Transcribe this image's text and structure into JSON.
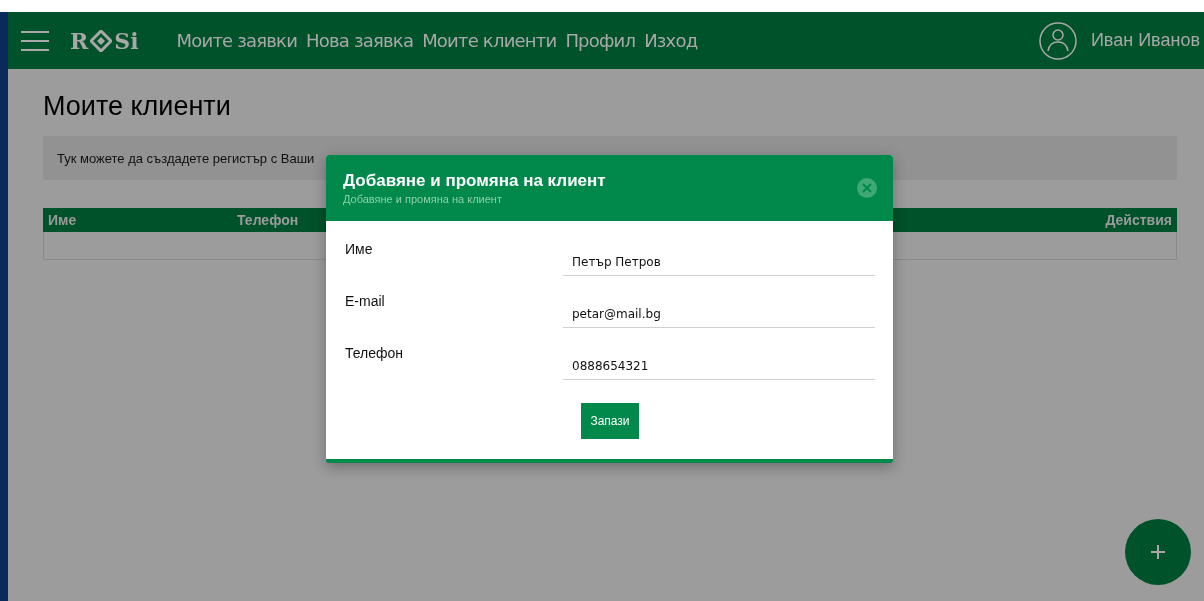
{
  "header": {
    "logo": {
      "left": "R",
      "right": "Si"
    },
    "nav": [
      {
        "label": "Моите заявки",
        "selected": false
      },
      {
        "label": "Нова заявка",
        "selected": false
      },
      {
        "label": "Моите клиенти",
        "selected": false
      },
      {
        "label": "Профил",
        "selected": false
      },
      {
        "label": "Изход",
        "selected": false
      }
    ],
    "user": "Иван Иванов"
  },
  "page": {
    "title": "Моите клиенти",
    "info": "Тук можете да създадете регистър с Ваши",
    "table": {
      "columns": [
        "Име",
        "Телефон",
        "Действия"
      ]
    }
  },
  "modal": {
    "title": "Добавяне и промяна на клиент",
    "subtitle": "Добавяне и промяна на клиент",
    "fields": [
      {
        "label": "Име",
        "value": "Петър Петров"
      },
      {
        "label": "E-mail",
        "value": "petar@mail.bg"
      },
      {
        "label": "Телефон",
        "value": "0888654321"
      }
    ],
    "button": "Запази"
  }
}
